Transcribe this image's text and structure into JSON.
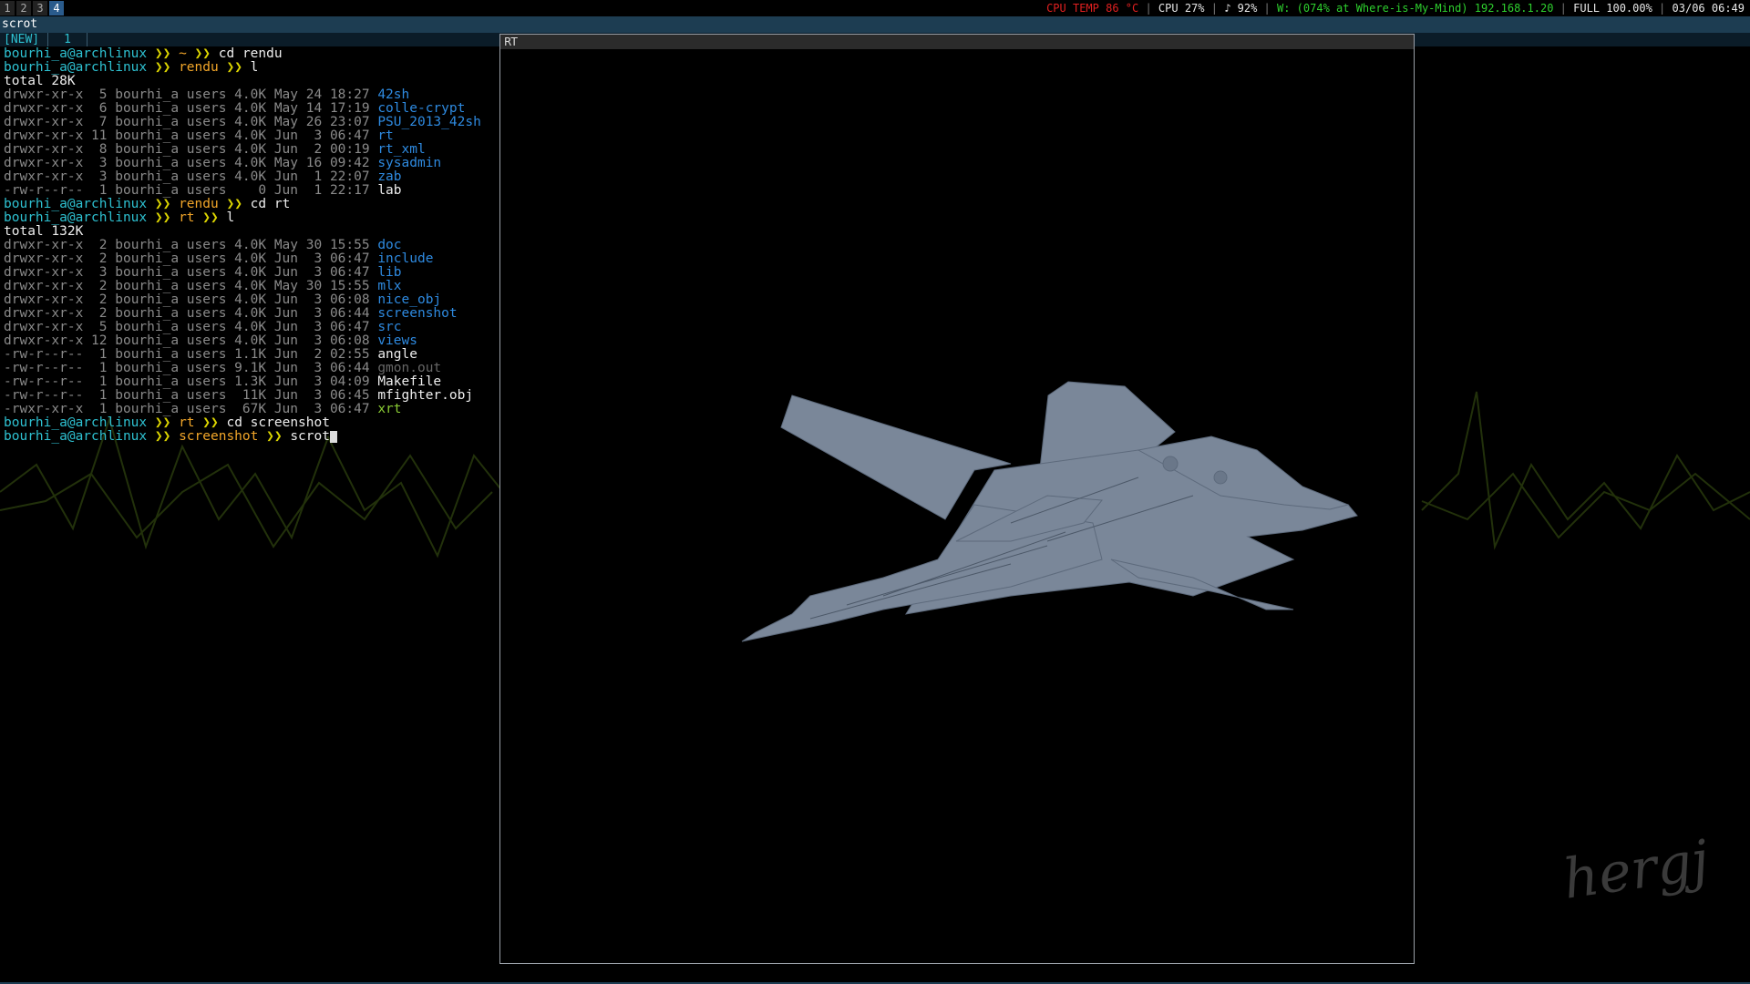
{
  "topbar": {
    "workspaces": [
      "1",
      "2",
      "3",
      "4"
    ],
    "active_workspace": "4",
    "status": {
      "cpu_temp": "CPU TEMP 86 °C",
      "cpu": "CPU 27%",
      "volume": "♪ 92%",
      "wifi": "W: (074% at Where-is-My-Mind) 192.168.1.20",
      "battery": "FULL 100.00%",
      "datetime": "03/06 06:49"
    },
    "colors": {
      "cpu_temp": "#e02020",
      "wifi": "#2ed02e",
      "text": "#e8e8e8"
    }
  },
  "title_line": "scrot",
  "tabs": {
    "new_label": "[NEW]",
    "tab1_label": "1"
  },
  "terminal": {
    "user": "bourhi_a@archlinux",
    "cmd1": {
      "dir": "~",
      "cmd": "cd rendu"
    },
    "cmd2": {
      "dir": "rendu",
      "cmd": "l"
    },
    "total1": "total 28K",
    "list1": [
      {
        "perm": "drwxr-xr-x",
        "meta": " 5 bourhi_a users 4.0K May 24 18:27",
        "name": "42sh",
        "color": "blue"
      },
      {
        "perm": "drwxr-xr-x",
        "meta": " 6 bourhi_a users 4.0K May 14 17:19",
        "name": "colle-crypt",
        "color": "blue"
      },
      {
        "perm": "drwxr-xr-x",
        "meta": " 7 bourhi_a users 4.0K May 26 23:07",
        "name": "PSU_2013_42sh",
        "color": "blue"
      },
      {
        "perm": "drwxr-xr-x",
        "meta": "11 bourhi_a users 4.0K Jun  3 06:47",
        "name": "rt",
        "color": "blue"
      },
      {
        "perm": "drwxr-xr-x",
        "meta": " 8 bourhi_a users 4.0K Jun  2 00:19",
        "name": "rt_xml",
        "color": "blue"
      },
      {
        "perm": "drwxr-xr-x",
        "meta": " 3 bourhi_a users 4.0K May 16 09:42",
        "name": "sysadmin",
        "color": "blue"
      },
      {
        "perm": "drwxr-xr-x",
        "meta": " 3 bourhi_a users 4.0K Jun  1 22:07",
        "name": "zab",
        "color": "blue"
      },
      {
        "perm": "-rw-r--r--",
        "meta": " 1 bourhi_a users    0 Jun  1 22:17",
        "name": "lab",
        "color": "white"
      }
    ],
    "cmd3": {
      "dir": "rendu",
      "cmd": "cd rt"
    },
    "cmd4": {
      "dir": "rt",
      "cmd": "l"
    },
    "total2": "total 132K",
    "list2": [
      {
        "perm": "drwxr-xr-x",
        "meta": " 2 bourhi_a users 4.0K May 30 15:55",
        "name": "doc",
        "color": "blue"
      },
      {
        "perm": "drwxr-xr-x",
        "meta": " 2 bourhi_a users 4.0K Jun  3 06:47",
        "name": "include",
        "color": "blue"
      },
      {
        "perm": "drwxr-xr-x",
        "meta": " 3 bourhi_a users 4.0K Jun  3 06:47",
        "name": "lib",
        "color": "blue"
      },
      {
        "perm": "drwxr-xr-x",
        "meta": " 2 bourhi_a users 4.0K May 30 15:55",
        "name": "mlx",
        "color": "blue"
      },
      {
        "perm": "drwxr-xr-x",
        "meta": " 2 bourhi_a users 4.0K Jun  3 06:08",
        "name": "nice_obj",
        "color": "blue"
      },
      {
        "perm": "drwxr-xr-x",
        "meta": " 2 bourhi_a users 4.0K Jun  3 06:44",
        "name": "screenshot",
        "color": "blue"
      },
      {
        "perm": "drwxr-xr-x",
        "meta": " 5 bourhi_a users 4.0K Jun  3 06:47",
        "name": "src",
        "color": "blue"
      },
      {
        "perm": "drwxr-xr-x",
        "meta": "12 bourhi_a users 4.0K Jun  3 06:08",
        "name": "views",
        "color": "blue"
      },
      {
        "perm": "-rw-r--r--",
        "meta": " 1 bourhi_a users 1.1K Jun  2 02:55",
        "name": "angle",
        "color": "white"
      },
      {
        "perm": "-rw-r--r--",
        "meta": " 1 bourhi_a users 9.1K Jun  3 06:44",
        "name": "gmon.out",
        "color": "gray"
      },
      {
        "perm": "-rw-r--r--",
        "meta": " 1 bourhi_a users 1.3K Jun  3 04:09",
        "name": "Makefile",
        "color": "white"
      },
      {
        "perm": "-rw-r--r--",
        "meta": " 1 bourhi_a users  11K Jun  3 06:45",
        "name": "mfighter.obj",
        "color": "white"
      },
      {
        "perm": "-rwxr-xr-x",
        "meta": " 1 bourhi_a users  67K Jun  3 06:47",
        "name": "xrt",
        "color": "green"
      }
    ],
    "cmd5": {
      "dir": "rt",
      "cmd": "cd screenshot"
    },
    "cmd6": {
      "dir": "screenshot",
      "cmd": "scrot"
    },
    "prompt_arrow": "❯❯"
  },
  "rt_window": {
    "title": "RT",
    "model_color": "#7a8799"
  }
}
